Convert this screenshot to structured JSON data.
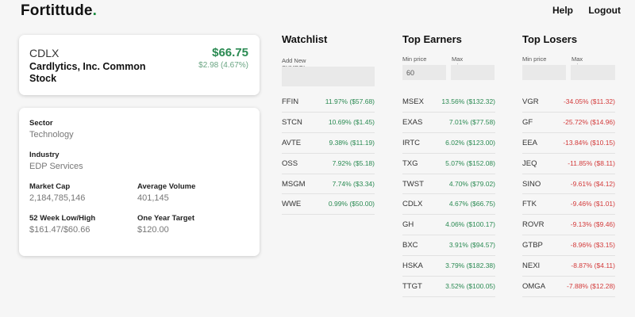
{
  "brand": {
    "name": "Fortittude",
    "dot": "."
  },
  "nav": {
    "help": "Help",
    "logout": "Logout"
  },
  "quote": {
    "symbol": "CDLX",
    "name": "Cardlytics, Inc. Common Stock",
    "price": "$66.75",
    "change": "$2.98 (4.67%)"
  },
  "info": {
    "sector_label": "Sector",
    "sector": "Technology",
    "industry_label": "Industry",
    "industry": "EDP Services",
    "market_cap_label": "Market Cap",
    "market_cap": "2,184,785,146",
    "avg_volume_label": "Average Volume",
    "avg_volume": "401,145",
    "week52_label": "52 Week Low/High",
    "week52": "$161.47/$60.66",
    "target_label": "One Year Target",
    "target": "$120.00"
  },
  "watchlist": {
    "title": "Watchlist",
    "add_label": "Add New SYMBOL",
    "add_value": "",
    "items": [
      {
        "symbol": "FFIN",
        "value": "11.97% ($57.68)"
      },
      {
        "symbol": "STCN",
        "value": "10.69% ($1.45)"
      },
      {
        "symbol": "AVTE",
        "value": "9.38% ($11.19)"
      },
      {
        "symbol": "OSS",
        "value": "7.92% ($5.18)"
      },
      {
        "symbol": "MSGM",
        "value": "7.74% ($3.34)"
      },
      {
        "symbol": "WWE",
        "value": "0.99% ($50.00)"
      }
    ]
  },
  "earners": {
    "title": "Top Earners",
    "min_label": "Min price",
    "max_label": "Max price",
    "min_value": "60",
    "max_value": "",
    "items": [
      {
        "symbol": "MSEX",
        "value": "13.56% ($132.32)"
      },
      {
        "symbol": "EXAS",
        "value": "7.01% ($77.58)"
      },
      {
        "symbol": "IRTC",
        "value": "6.02% ($123.00)"
      },
      {
        "symbol": "TXG",
        "value": "5.07% ($152.08)"
      },
      {
        "symbol": "TWST",
        "value": "4.70% ($79.02)"
      },
      {
        "symbol": "CDLX",
        "value": "4.67% ($66.75)"
      },
      {
        "symbol": "GH",
        "value": "4.06% ($100.17)"
      },
      {
        "symbol": "BXC",
        "value": "3.91% ($94.57)"
      },
      {
        "symbol": "HSKA",
        "value": "3.79% ($182.38)"
      },
      {
        "symbol": "TTGT",
        "value": "3.52% ($100.05)"
      }
    ]
  },
  "losers": {
    "title": "Top Losers",
    "min_label": "Min price",
    "max_label": "Max price",
    "min_value": "",
    "max_value": "",
    "items": [
      {
        "symbol": "VGR",
        "value": "-34.05% ($11.32)"
      },
      {
        "symbol": "GF",
        "value": "-25.72% ($14.96)"
      },
      {
        "symbol": "EEA",
        "value": "-13.84% ($10.15)"
      },
      {
        "symbol": "JEQ",
        "value": "-11.85% ($8.11)"
      },
      {
        "symbol": "SINO",
        "value": "-9.61% ($4.12)"
      },
      {
        "symbol": "FTK",
        "value": "-9.46% ($1.01)"
      },
      {
        "symbol": "ROVR",
        "value": "-9.13% ($9.46)"
      },
      {
        "symbol": "GTBP",
        "value": "-8.96% ($3.15)"
      },
      {
        "symbol": "NEXI",
        "value": "-8.87% ($4.11)"
      },
      {
        "symbol": "OMGA",
        "value": "-7.88% ($12.28)"
      }
    ]
  },
  "colors": {
    "positive": "#2a8a52",
    "negative": "#d33a3a",
    "brand_dot": "#1a8a3e"
  }
}
